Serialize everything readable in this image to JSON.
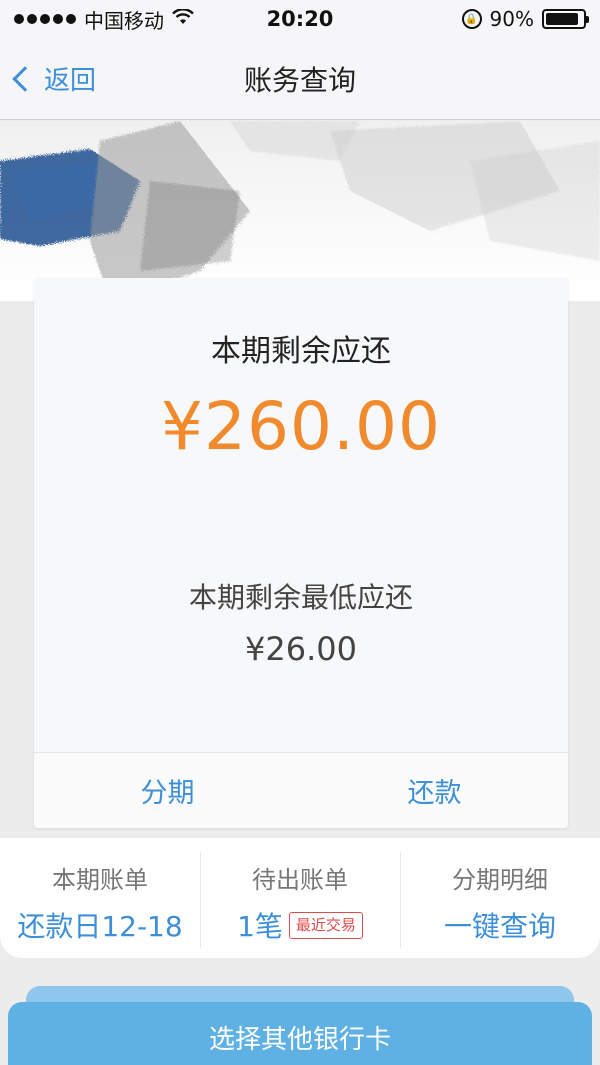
{
  "status_bar": {
    "carrier": "中国移动",
    "time": "20:20",
    "battery": "90%",
    "battery_level": 0.9
  },
  "nav": {
    "back_label": "返回",
    "title": "账务查询"
  },
  "card": {
    "title": "本期剩余应还",
    "amount": "¥260.00",
    "min_label": "本期剩余最低应还",
    "min_amount": "¥26.00",
    "actions": [
      "分期",
      "还款"
    ]
  },
  "summary": [
    {
      "label": "本期账单",
      "value": "还款日12-18"
    },
    {
      "label": "待出账单",
      "value": "1笔",
      "badge": "最近交易"
    },
    {
      "label": "分期明细",
      "value": "一键查询"
    }
  ],
  "bottom_button": "选择其他银行卡",
  "colors": {
    "accent": "#3d8fd8",
    "amount": "#f08a2c",
    "badge": "#e04b4b",
    "button": "#5fb1e3"
  },
  "icons": [
    "signal-dots-icon",
    "wifi-icon",
    "rotation-lock-icon",
    "battery-icon",
    "chevron-left-icon"
  ]
}
